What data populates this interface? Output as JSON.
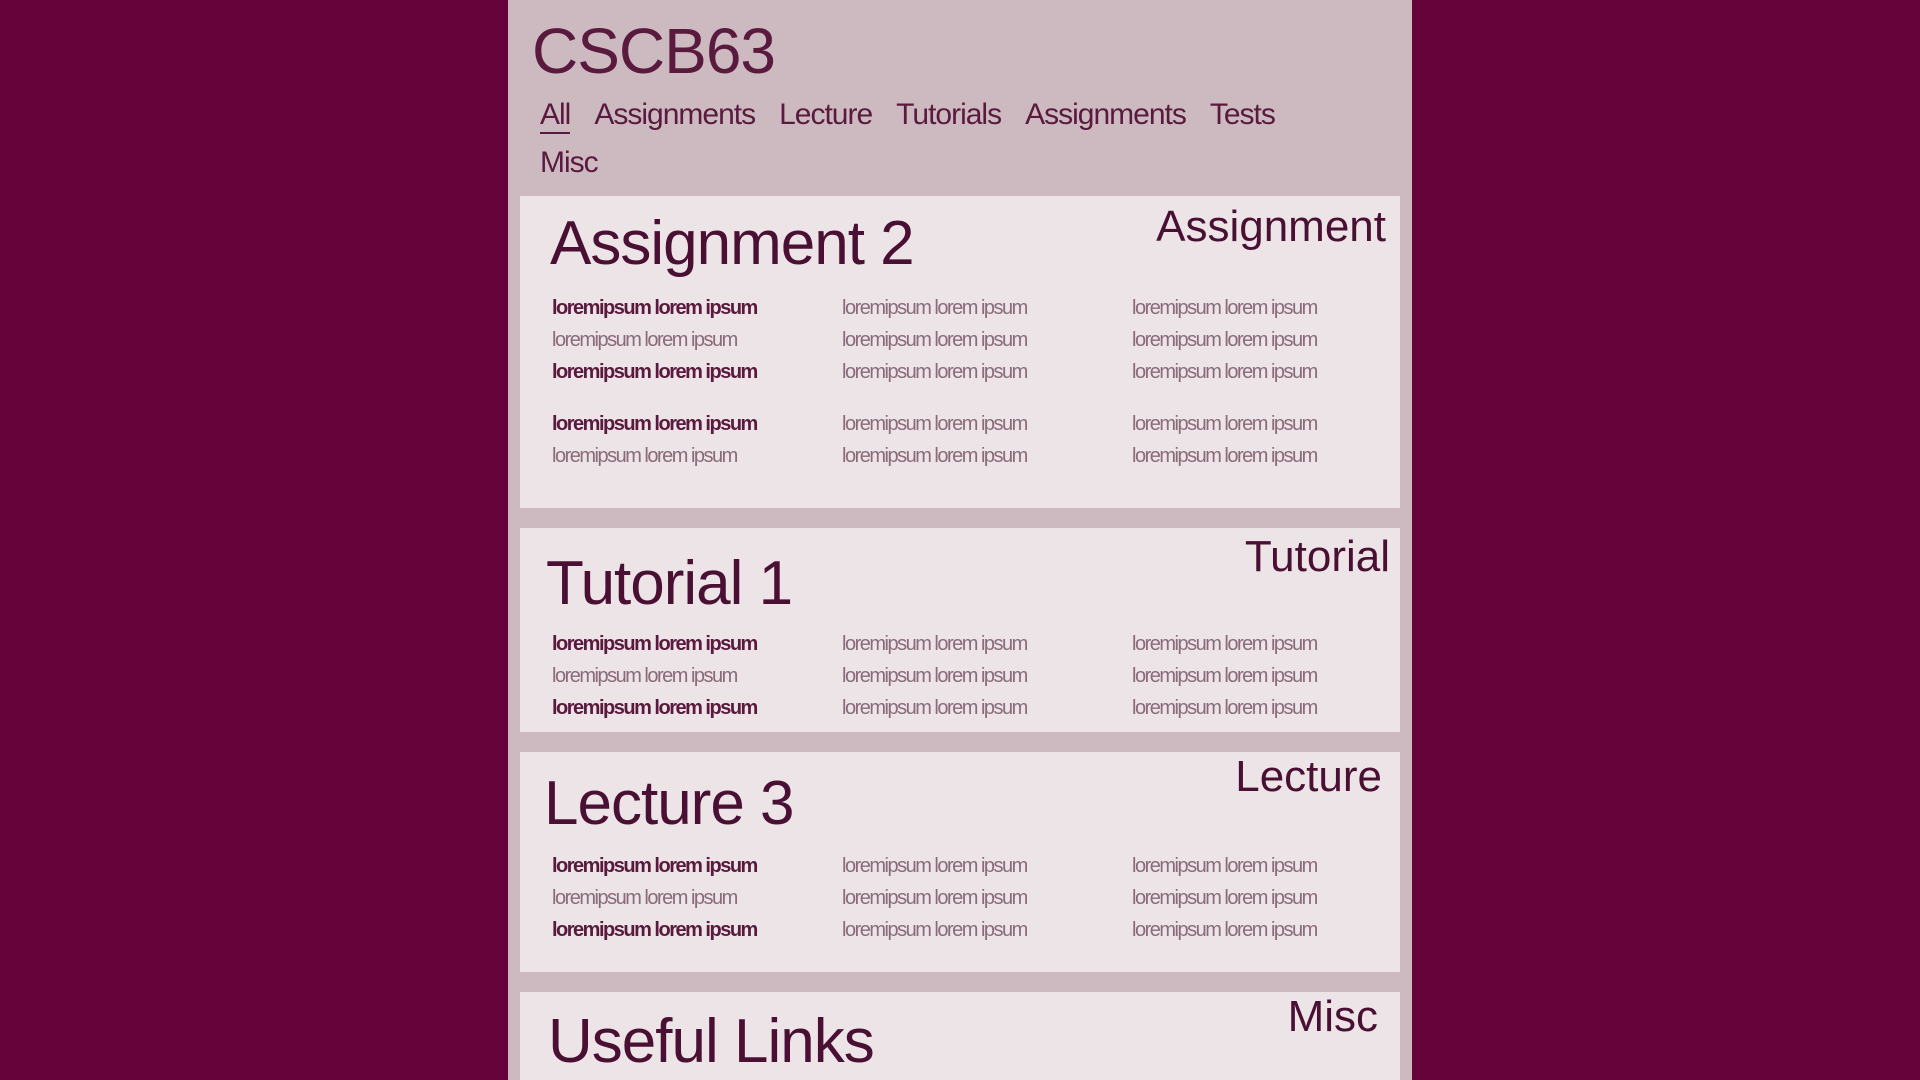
{
  "course_title": "CSCB63",
  "nav": [
    {
      "label": "All"
    },
    {
      "label": "Assignments"
    },
    {
      "label": "Lecture"
    },
    {
      "label": "Tutorials"
    },
    {
      "label": "Assignments"
    },
    {
      "label": "Tests"
    },
    {
      "label": "Misc"
    }
  ],
  "active_nav": "All",
  "cards": [
    {
      "title": "Assignment 2",
      "tag": "Assignment"
    },
    {
      "title": "Tutorial 1",
      "tag": "Tutorial"
    },
    {
      "title": "Lecture 3",
      "tag": "Lecture"
    },
    {
      "title": "Useful Links",
      "tag": "Misc"
    }
  ],
  "placeholder_text": "loremipsum lorem ipsum",
  "colors": {
    "background": "#66033a",
    "panel": "#ccbac0",
    "card": "#ece4e6",
    "text": "#4a1033"
  }
}
